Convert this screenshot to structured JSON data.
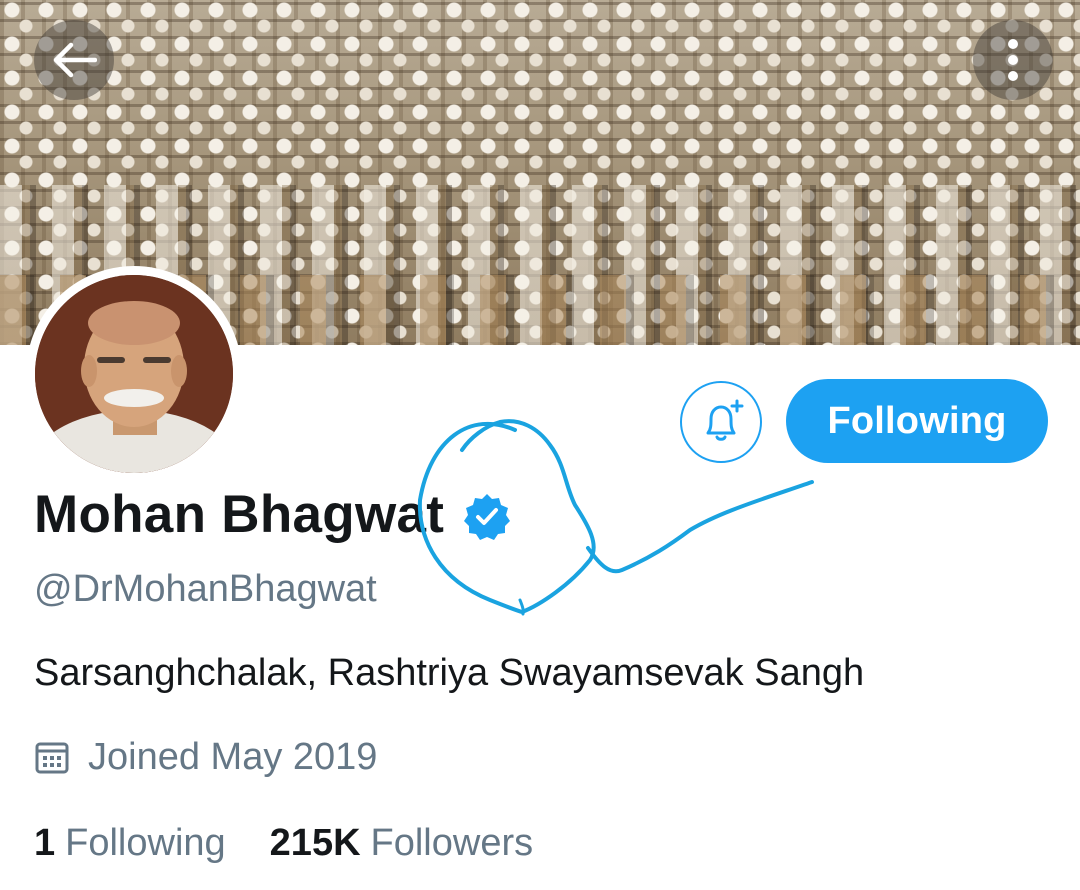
{
  "header": {
    "back_icon": "arrow-left-icon",
    "more_icon": "more-vertical-icon"
  },
  "profile": {
    "name": "Mohan Bhagwat",
    "verified_icon": "verified-badge-icon",
    "handle": "@DrMohanBhagwat",
    "bio": "Sarsanghchalak, Rashtriya Swayamsevak Sangh",
    "joined_icon": "calendar-icon",
    "joined": "Joined May 2019"
  },
  "actions": {
    "notify_icon": "bell-plus-icon",
    "follow_label": "Following"
  },
  "stats": {
    "following_count": "1",
    "following_label": "Following",
    "followers_count": "215K",
    "followers_label": "Followers"
  },
  "colors": {
    "accent": "#1da1f2",
    "text_primary": "#14171a",
    "text_secondary": "#657786",
    "annotation_ink": "#1aa3e0"
  }
}
